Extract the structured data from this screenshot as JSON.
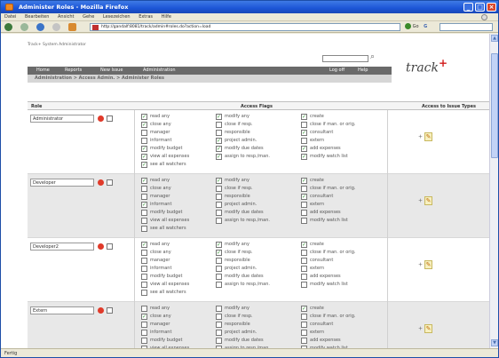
{
  "window": {
    "title": "Administer Roles - Mozilla Firefox"
  },
  "menu": [
    "Datei",
    "Bearbeiten",
    "Ansicht",
    "Gehe",
    "Lesezeichen",
    "Extras",
    "Hilfe"
  ],
  "address": {
    "url": "http://gandalf:8081/track/admin#roles.do?action=load",
    "go_label": "Go"
  },
  "status": "Fertig",
  "page": {
    "breadcrumb_top": "Track+ System Administrator",
    "logo_text": "track",
    "logo_plus": "+",
    "nav": {
      "home": "Home",
      "reports": "Reports",
      "new_issue": "New Issue",
      "administration": "Administration",
      "logoff": "Log off",
      "help": "Help"
    },
    "subnav": "Administration > Access Admin. > Administer Roles"
  },
  "table": {
    "headers": {
      "role": "Role",
      "flags": "Access Flags",
      "issue_types": "Access to Issue Types"
    },
    "flag_columns": [
      [
        "read any",
        "close any",
        "manager",
        "informant",
        "modify budget",
        "view all expenses",
        "see all watchers"
      ],
      [
        "modify any",
        "close if resp.",
        "responsible",
        "project admin.",
        "modify due dates",
        "assign to resp./man."
      ],
      [
        "create",
        "close if man. or orig.",
        "consultant",
        "extern",
        "add expenses",
        "modify watch list"
      ]
    ],
    "roles": [
      {
        "name": "Administrator",
        "checked": [
          [
            1,
            1,
            0,
            0,
            1,
            1,
            1
          ],
          [
            1,
            0,
            0,
            1,
            1,
            1
          ],
          [
            1,
            0,
            1,
            0,
            1,
            1
          ]
        ]
      },
      {
        "name": "Developer",
        "checked": [
          [
            1,
            0,
            0,
            1,
            0,
            0,
            0
          ],
          [
            1,
            0,
            0,
            0,
            0,
            0
          ],
          [
            1,
            0,
            1,
            0,
            0,
            0
          ]
        ]
      },
      {
        "name": "Developer2",
        "checked": [
          [
            1,
            0,
            0,
            0,
            0,
            0,
            0
          ],
          [
            1,
            1,
            0,
            0,
            0,
            0
          ],
          [
            1,
            0,
            0,
            0,
            0,
            0
          ]
        ]
      },
      {
        "name": "Extern",
        "checked": [
          [
            0,
            1,
            0,
            0,
            0,
            0,
            0
          ],
          [
            0,
            0,
            0,
            0,
            0,
            0
          ],
          [
            1,
            0,
            0,
            0,
            0,
            0
          ]
        ]
      }
    ]
  }
}
